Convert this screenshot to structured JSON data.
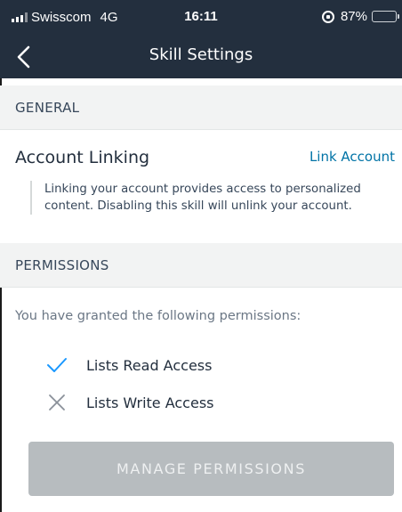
{
  "status_bar": {
    "carrier": "Swisscom",
    "network": "4G",
    "time": "16:11",
    "battery": "87%",
    "battery_level_percent": 87,
    "battery_color": "#4cd964"
  },
  "nav": {
    "title": "Skill Settings",
    "back_icon": "chevron-left-icon"
  },
  "general": {
    "header": "GENERAL",
    "account_linking": {
      "title": "Account Linking",
      "link_label": "Link Account",
      "description": "Linking your account provides access to personalized content. Disabling this skill will unlink your account."
    }
  },
  "permissions": {
    "header": "PERMISSIONS",
    "intro": "You have granted the following permissions:",
    "items": [
      {
        "label": "Lists Read Access",
        "granted": true,
        "icon": "check-icon"
      },
      {
        "label": "Lists Write Access",
        "granted": false,
        "icon": "x-icon"
      }
    ],
    "manage_button": "MANAGE PERMISSIONS"
  },
  "colors": {
    "header_bg": "#232f3e",
    "link": "#0073a6",
    "check": "#1a98ff",
    "button_bg": "#b7bcbf"
  }
}
